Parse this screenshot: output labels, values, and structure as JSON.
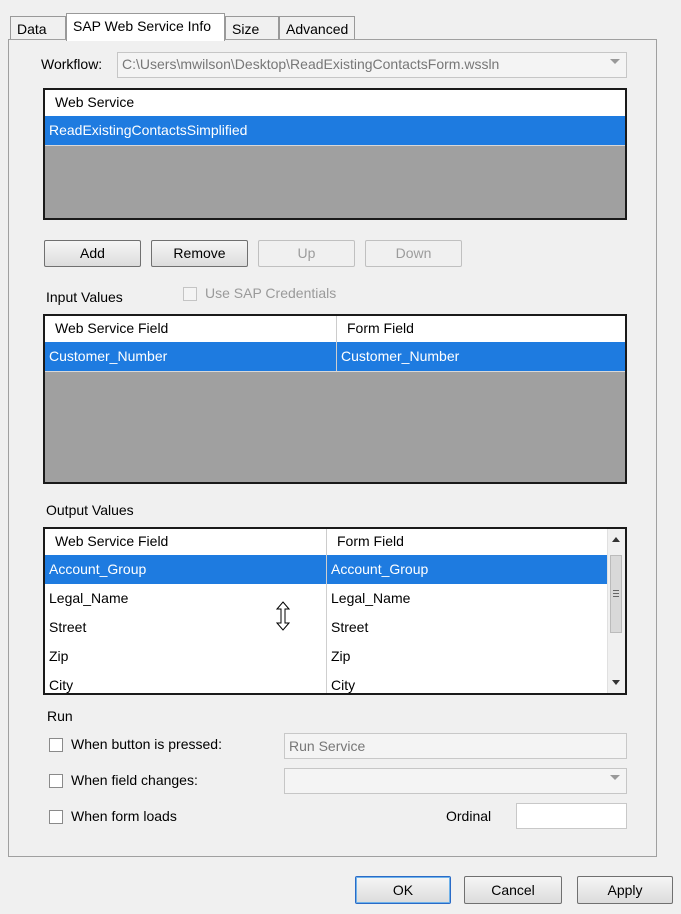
{
  "tabs": [
    {
      "label": "Data",
      "active": false
    },
    {
      "label": "SAP Web Service Info",
      "active": true
    },
    {
      "label": "Size",
      "active": false
    },
    {
      "label": "Advanced",
      "active": false
    }
  ],
  "workflow": {
    "label": "Workflow:",
    "value": "C:\\Users\\mwilson\\Desktop\\ReadExistingContactsForm.wssln"
  },
  "web_service_list": {
    "header": "Web Service",
    "rows": [
      "ReadExistingContactsSimplified"
    ],
    "selected_index": 0
  },
  "list_buttons": {
    "add": "Add",
    "remove": "Remove",
    "up": "Up",
    "down": "Down"
  },
  "input_values": {
    "label": "Input Values",
    "use_sap_credentials": "Use SAP Credentials",
    "columns": [
      "Web Service Field",
      "Form Field"
    ],
    "rows": [
      {
        "web_service_field": "Customer_Number",
        "form_field": "Customer_Number"
      }
    ]
  },
  "output_values": {
    "label": "Output Values",
    "columns": [
      "Web Service Field",
      "Form Field"
    ],
    "rows": [
      {
        "web_service_field": "Account_Group",
        "form_field": "Account_Group"
      },
      {
        "web_service_field": "Legal_Name",
        "form_field": "Legal_Name"
      },
      {
        "web_service_field": "Street",
        "form_field": "Street"
      },
      {
        "web_service_field": "Zip",
        "form_field": "Zip"
      },
      {
        "web_service_field": "City",
        "form_field": "City"
      }
    ]
  },
  "run": {
    "label": "Run",
    "when_button_pressed": "When button is pressed:",
    "button_text_value": "Run Service",
    "when_field_changes": "When field changes:",
    "field_select_value": "",
    "when_form_loads": "When form loads",
    "ordinal_label": "Ordinal",
    "ordinal_value": ""
  },
  "dialog_buttons": {
    "ok": "OK",
    "cancel": "Cancel",
    "apply": "Apply"
  },
  "colors": {
    "selection": "#1e7be0",
    "grid_empty_area": "#a0a0a0",
    "dialog_bg": "#f0f0f0"
  }
}
